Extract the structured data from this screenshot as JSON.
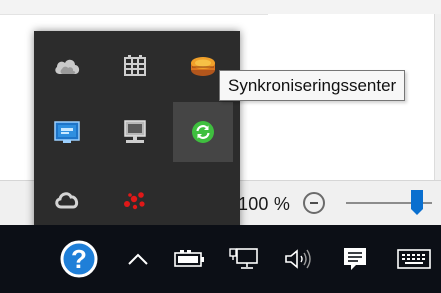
{
  "app_window": {
    "zoom_level": "100 %",
    "zoom_slider_fraction": 0.75
  },
  "tray_overflow": {
    "icons": [
      {
        "name": "onedrive-cloud-icon",
        "row": 0,
        "col": 0
      },
      {
        "name": "grid-app-icon",
        "row": 0,
        "col": 1
      },
      {
        "name": "orange-disk-icon",
        "row": 0,
        "col": 2
      },
      {
        "name": "intel-graphics-icon",
        "row": 1,
        "col": 0
      },
      {
        "name": "network-monitor-icon",
        "row": 1,
        "col": 1
      },
      {
        "name": "sync-center-icon",
        "row": 1,
        "col": 2,
        "highlighted": true
      },
      {
        "name": "creative-cloud-icon",
        "row": 2,
        "col": 0
      },
      {
        "name": "red-dots-icon",
        "row": 2,
        "col": 1
      }
    ]
  },
  "tooltip": {
    "text": "Synkroniseringssenter"
  },
  "taskbar": {
    "items": [
      "help-icon",
      "show-hidden-icons-chevron",
      "battery-icon",
      "network-icon",
      "volume-icon",
      "action-center-icon",
      "touch-keyboard-icon"
    ]
  },
  "colors": {
    "flyout_bg": "#2c2c2c",
    "flyout_hover": "#454545",
    "taskbar_bg": "#0c0f16",
    "help_blue": "#1f7fd8",
    "sync_green": "#3fbf3f",
    "slider_thumb": "#0a6fcf"
  }
}
